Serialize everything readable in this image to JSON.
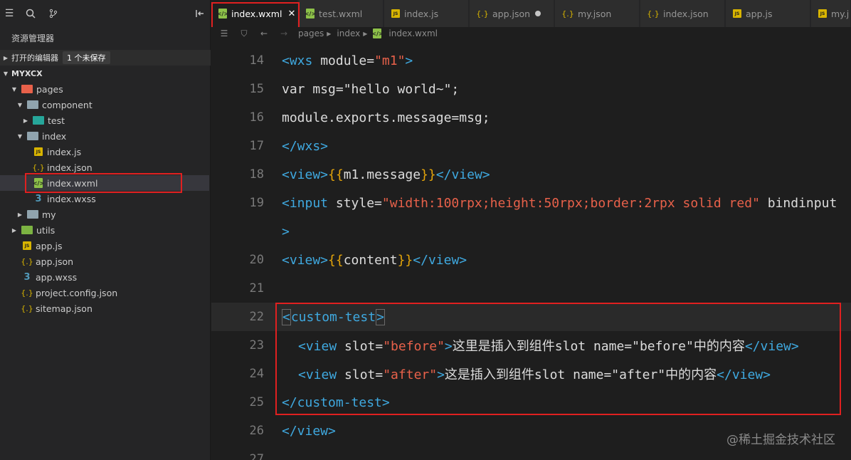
{
  "sidebar": {
    "title": "资源管理器",
    "open_editors_label": "打开的编辑器",
    "unsaved_badge": "1 个未保存",
    "project_name": "MYXCX",
    "tree": [
      {
        "label": "pages"
      },
      {
        "label": "component"
      },
      {
        "label": "test"
      },
      {
        "label": "index"
      },
      {
        "label": "index.js"
      },
      {
        "label": "index.json"
      },
      {
        "label": "index.wxml"
      },
      {
        "label": "index.wxss"
      },
      {
        "label": "my"
      },
      {
        "label": "utils"
      },
      {
        "label": "app.js"
      },
      {
        "label": "app.json"
      },
      {
        "label": "app.wxss"
      },
      {
        "label": "project.config.json"
      },
      {
        "label": "sitemap.json"
      }
    ]
  },
  "tabs": [
    {
      "label": "index.wxml",
      "icon": "wxml-icon"
    },
    {
      "label": "test.wxml",
      "icon": "wxml-icon"
    },
    {
      "label": "index.js",
      "icon": "js-icon"
    },
    {
      "label": "app.json",
      "icon": "json-icon"
    },
    {
      "label": "my.json",
      "icon": "json-icon"
    },
    {
      "label": "index.json",
      "icon": "json-icon"
    },
    {
      "label": "app.js",
      "icon": "js-icon"
    },
    {
      "label": "my.j",
      "icon": "js-icon"
    }
  ],
  "breadcrumb": [
    "pages",
    "index",
    "index.wxml"
  ],
  "code": {
    "line_numbers": [
      "14",
      "15",
      "16",
      "17",
      "18",
      "19",
      "",
      "20",
      "21",
      "22",
      "23",
      "24",
      "25",
      "26",
      "27"
    ],
    "l14": {
      "open": "<wxs",
      "attr": " module=",
      "val": "\"m1\"",
      "close": ">"
    },
    "l15": "var msg=\"hello world~\";",
    "l16": "module.exports.message=msg;",
    "l17": "</wxs>",
    "l18": {
      "open": "<view>",
      "b1": "{{",
      "expr": "m1.message",
      "b2": "}}",
      "close": "</view>"
    },
    "l19": {
      "open": "<input",
      "attr": " style=",
      "val": "\"width:100rpx;height:50rpx;border:2rpx solid red\"",
      "rest": " bindinput"
    },
    "l19b": ">",
    "l20": {
      "open": "<view>",
      "b1": "{{",
      "expr": "content",
      "b2": "}}",
      "close": "</view>"
    },
    "l22": {
      "lt": "<",
      "name": "custom-test",
      "gt": ">"
    },
    "l23": {
      "open": "<view",
      "attr": " slot=",
      "val": "\"before\"",
      "gt": ">",
      "text": "这里是插入到组件slot name=\"before\"中的内容",
      "close": "</view>"
    },
    "l24": {
      "open": "<view",
      "attr": " slot=",
      "val": "\"after\"",
      "gt": ">",
      "text": "这是插入到组件slot name=\"after\"中的内容",
      "close": "</view>"
    },
    "l25": "</custom-test>",
    "l26": "</view>"
  },
  "watermark": "@稀土掘金技术社区",
  "colors": {
    "tag": "#3fa9e0",
    "string": "#e8614a",
    "brace": "#e5a50a",
    "highlight": "#e02020"
  }
}
